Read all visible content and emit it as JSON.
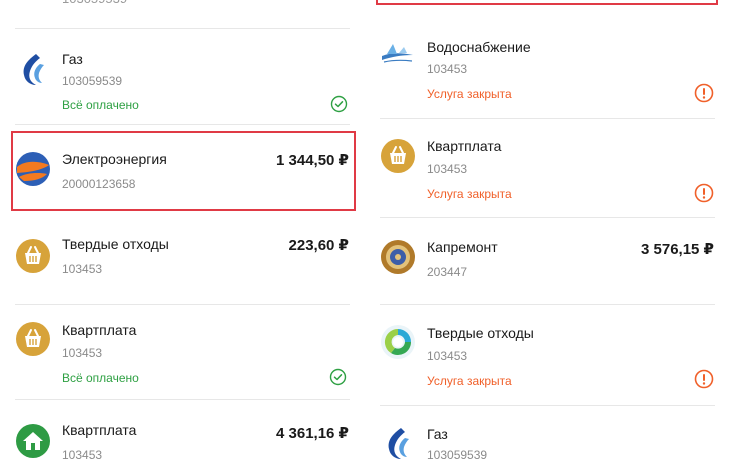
{
  "left_column": {
    "top_fragment": "103059539",
    "rows": [
      {
        "title": "Газ",
        "account": "103059539",
        "amount": "",
        "status": "Всё оплачено",
        "status_type": "paid",
        "icon": "gas-flame-icon"
      },
      {
        "title": "Электроэнергия",
        "account": "20000123658",
        "amount": "1 344,50 ₽",
        "status": "",
        "status_type": "",
        "icon": "electricity-globe-icon"
      },
      {
        "title": "Твердые отходы",
        "account": "103453",
        "amount": "223,60 ₽",
        "status": "",
        "status_type": "",
        "icon": "basket-icon"
      },
      {
        "title": "Квартплата",
        "account": "103453",
        "amount": "",
        "status": "Всё оплачено",
        "status_type": "paid",
        "icon": "basket-icon"
      },
      {
        "title": "Квартплата",
        "account": "103453",
        "amount": "4 361,16 ₽",
        "status": "",
        "status_type": "",
        "icon": "house-icon"
      }
    ]
  },
  "right_column": {
    "rows": [
      {
        "title": "Водоснабжение",
        "account": "103453",
        "amount": "",
        "status": "Услуга закрыта",
        "status_type": "closed",
        "icon": "water-supply-icon"
      },
      {
        "title": "Квартплата",
        "account": "103453",
        "amount": "",
        "status": "Услуга закрыта",
        "status_type": "closed",
        "icon": "basket-icon"
      },
      {
        "title": "Капремонт",
        "account": "203447",
        "amount": "3 576,15 ₽",
        "status": "",
        "status_type": "",
        "icon": "capital-repair-emblem-icon"
      },
      {
        "title": "Твердые отходы",
        "account": "103453",
        "amount": "",
        "status": "Услуга закрыта",
        "status_type": "closed",
        "icon": "recycling-icon"
      },
      {
        "title": "Газ",
        "account": "103059539",
        "amount": "",
        "status": "",
        "status_type": "",
        "icon": "gas-flame-icon"
      }
    ]
  },
  "colors": {
    "paid": "#2ea043",
    "closed": "#f0602a",
    "highlight": "#e03a45",
    "basket_gold": "#d7a33a",
    "house_green": "#2e9b44"
  }
}
